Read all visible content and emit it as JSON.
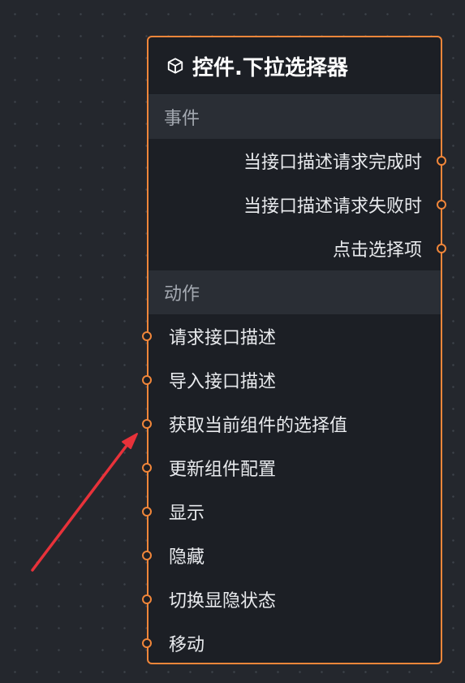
{
  "node": {
    "title": "控件.下拉选择器",
    "icon": "cube-icon",
    "accent_color": "#f0863a",
    "events_section": {
      "label": "事件",
      "items": [
        {
          "label": "当接口描述请求完成时"
        },
        {
          "label": "当接口描述请求失败时"
        },
        {
          "label": "点击选择项"
        }
      ]
    },
    "actions_section": {
      "label": "动作",
      "items": [
        {
          "label": "请求接口描述"
        },
        {
          "label": "导入接口描述"
        },
        {
          "label": "获取当前组件的选择值"
        },
        {
          "label": "更新组件配置"
        },
        {
          "label": "显示"
        },
        {
          "label": "隐藏"
        },
        {
          "label": "切换显隐状态"
        },
        {
          "label": "移动"
        }
      ]
    }
  },
  "annotation": {
    "icon": "red-arrow-icon",
    "color": "#e8323a"
  }
}
